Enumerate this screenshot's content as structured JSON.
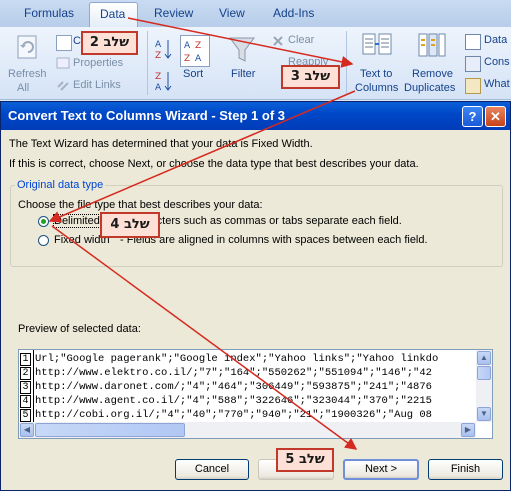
{
  "ribbon": {
    "tabs": [
      "Formulas",
      "Data",
      "Review",
      "View",
      "Add-Ins"
    ],
    "active_tab": "Data",
    "refresh_label": "Refresh",
    "refresh_sub": "All",
    "connections_label": "C",
    "properties_label": "Properties",
    "edit_links_label": "Edit Links",
    "sort_label": "Sort",
    "filter_label": "Filter",
    "clear_label": "Clear",
    "reapply_label": "Reapply",
    "text_to_columns_line1": "Text to",
    "text_to_columns_line2": "Columns",
    "remove_dup_line1": "Remove",
    "remove_dup_line2": "Duplicates",
    "data_validation_label": "Data",
    "consolidate_label": "Cons",
    "whatif_label": "What"
  },
  "dialog": {
    "title": "Convert Text to Columns Wizard - Step 1 of 3",
    "line1": "The Text Wizard has determined that your data is Fixed Width.",
    "line2": "If this is correct, choose Next, or choose the data type that best describes your data.",
    "group_label": "Original data type",
    "choose_label": "Choose the file type that best describes your data:",
    "delimited_label": "Delimited",
    "delimited_desc": "- Characters such as commas or tabs separate each field.",
    "fixed_label": "Fixed width",
    "fixed_desc": "- Fields are aligned in columns with spaces between each field.",
    "preview_label": "Preview of selected data:",
    "preview_rows": [
      {
        "n": "1",
        "text": "Url;\"Google pagerank\";\"Google index\";\"Yahoo links\";\"Yahoo linkdo"
      },
      {
        "n": "2",
        "text": "http://www.elektro.co.il/;\"7\";\"164\";\"550262\";\"551094\";\"146\";\"42"
      },
      {
        "n": "3",
        "text": "http://www.daronet.com/;\"4\";\"464\";\"306449\";\"593875\";\"241\";\"4876"
      },
      {
        "n": "4",
        "text": "http://www.agent.co.il/;\"4\";\"588\";\"322646\";\"323044\";\"370\";\"2215"
      },
      {
        "n": "5",
        "text": "http://cobi.org.il/;\"4\";\"40\";\"770\";\"940\";\"21\";\"1900326\";\"Aug 08"
      }
    ],
    "buttons": {
      "cancel": "Cancel",
      "back": "< Back",
      "next": "Next >",
      "finish": "Finish"
    },
    "help_glyph": "?",
    "close_glyph": "✕"
  },
  "annotations": {
    "step2": "שלב 2",
    "step3": "שלב 3",
    "step4": "שלב 4",
    "step5": "שלב 5",
    "color": "#d62a20"
  }
}
